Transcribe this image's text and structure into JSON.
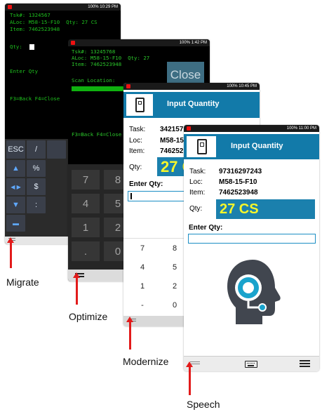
{
  "migrate": {
    "status_time": "100% 10:29 PM",
    "lines": [
      "Tsk#: 1324567",
      "ALoc: M58-15-F10  Qty: 27 CS",
      "Item: 7462523948",
      "",
      "Qty:",
      "",
      "",
      "Enter Qty",
      "",
      "",
      "",
      "F3=Back F4=Close"
    ],
    "keys": [
      "ESC",
      "/",
      "%",
      "$",
      ":"
    ],
    "label": "Migrate"
  },
  "optimize": {
    "status_time": "100% 1:42 PM",
    "lines": [
      "Tsk#: 13245768",
      "ALoc: M58-15-F10  Qty: 27",
      "Item: 7462523948",
      "",
      "Scan Location:"
    ],
    "fkeys": "F3=Back F4=Close",
    "close": "Close",
    "numpad": [
      "7",
      "8",
      "4",
      "5",
      "1",
      "2",
      ".",
      "0"
    ],
    "label": "Optimize"
  },
  "modernize": {
    "status_time": "100% 10:45 PM",
    "title": "Input Quantity",
    "task_label": "Task:",
    "task_value": "342157",
    "loc_label": "Loc:",
    "loc_value": "M58-15",
    "item_label": "Item:",
    "item_value": "746252",
    "qty_label": "Qty:",
    "qty_value": "27 C",
    "enter_label": "Enter Qty:",
    "numpad": [
      "7",
      "8",
      "4",
      "5",
      "1",
      "2",
      "-",
      "0"
    ],
    "label": "Modernize"
  },
  "speech": {
    "status_time": "100% 11:00 PM",
    "title": "Input Quantity",
    "task_label": "Task:",
    "task_value": "97316297243",
    "loc_label": "Loc:",
    "loc_value": "M58-15-F10",
    "item_label": "Item:",
    "item_value": "7462523948",
    "qty_label": "Qty:",
    "qty_value": "27 CS",
    "enter_label": "Enter Qty:",
    "label": "Speech"
  },
  "colors": {
    "accent": "#127aa9",
    "qty_text": "#f6f62a",
    "terminal_green": "#1ec01e",
    "arrow": "#e21b1b"
  }
}
